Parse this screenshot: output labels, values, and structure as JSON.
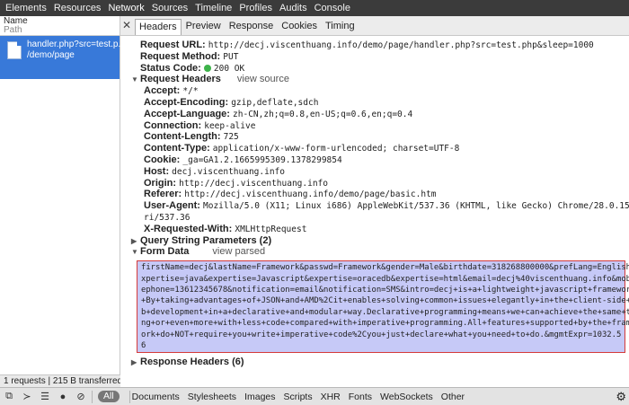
{
  "topbar": {
    "tabs": [
      "Elements",
      "Resources",
      "Network",
      "Sources",
      "Timeline",
      "Profiles",
      "Audits",
      "Console"
    ]
  },
  "left": {
    "header_name": "Name",
    "header_path": "Path",
    "request_name": "handler.php?src=test.p...",
    "request_path": "/demo/page",
    "status": "1 requests  |  215 B transferred"
  },
  "detail_tabs": [
    "Headers",
    "Preview",
    "Response",
    "Cookies",
    "Timing"
  ],
  "general": {
    "url_label": "Request URL:",
    "url_value": "http://decj.viscenthuang.info/demo/page/handler.php?src=test.php&sleep=1000",
    "method_label": "Request Method:",
    "method_value": "PUT",
    "status_label": "Status Code:",
    "status_value": "200 OK"
  },
  "request_headers": {
    "title": "Request Headers",
    "view": "view source",
    "items": [
      {
        "key": "Accept:",
        "value": "*/*"
      },
      {
        "key": "Accept-Encoding:",
        "value": "gzip,deflate,sdch"
      },
      {
        "key": "Accept-Language:",
        "value": "zh-CN,zh;q=0.8,en-US;q=0.6,en;q=0.4"
      },
      {
        "key": "Connection:",
        "value": "keep-alive"
      },
      {
        "key": "Content-Length:",
        "value": "725"
      },
      {
        "key": "Content-Type:",
        "value": "application/x-www-form-urlencoded; charset=UTF-8"
      },
      {
        "key": "Cookie:",
        "value": "_ga=GA1.2.1665995309.1378299854"
      },
      {
        "key": "Host:",
        "value": "decj.viscenthuang.info"
      },
      {
        "key": "Origin:",
        "value": "http://decj.viscenthuang.info"
      },
      {
        "key": "Referer:",
        "value": "http://decj.viscenthuang.info/demo/page/basic.htm"
      },
      {
        "key": "User-Agent:",
        "value": "Mozilla/5.0 (X11; Linux i686) AppleWebKit/537.36 (KHTML, like Gecko) Chrome/28.0.1500.71 Safa"
      },
      {
        "key": "",
        "value": "ri/537.36"
      },
      {
        "key": "X-Requested-With:",
        "value": "XMLHttpRequest"
      }
    ]
  },
  "query_params": {
    "title": "Query String Parameters (2)"
  },
  "form_data": {
    "title": "Form Data",
    "view": "view parsed",
    "lines": [
      "firstName=decj&lastName=Framework&passwd=Framework&gender=Male&birthdate=318268800000&prefLang=English&e",
      "xpertise=java&expertise=Javascript&expertise=oracedb&expertise=html&email=decj%40viscenthuang.info&mobil",
      "ephone=13612345678&notification=email&notification=SMS&intro=decj+is+a+lightweight+javascript+framework.",
      "+By+taking+advantages+of+JSON+and+AMD%2Cit+enables+solving+common+issues+elegantly+in+the+client-side+we",
      "b+development+in+a+declarative+and+modular+way.Declarative+programming+means+we+can+achieve+the+same+thi",
      "ng+or+even+more+with+less+code+compared+with+imperative+programming.All+features+supported+by+the+framew",
      "ork+do+NOT+require+you+write+imperative+code%2Cyou+just+declare+what+you+need+to+do.&mgmtExpr=1032.5",
      "6"
    ]
  },
  "response_headers": {
    "title": "Response Headers (6)"
  },
  "bottom": {
    "filters": [
      "All",
      "Documents",
      "Stylesheets",
      "Images",
      "Scripts",
      "XHR",
      "Fonts",
      "WebSockets",
      "Other"
    ]
  }
}
